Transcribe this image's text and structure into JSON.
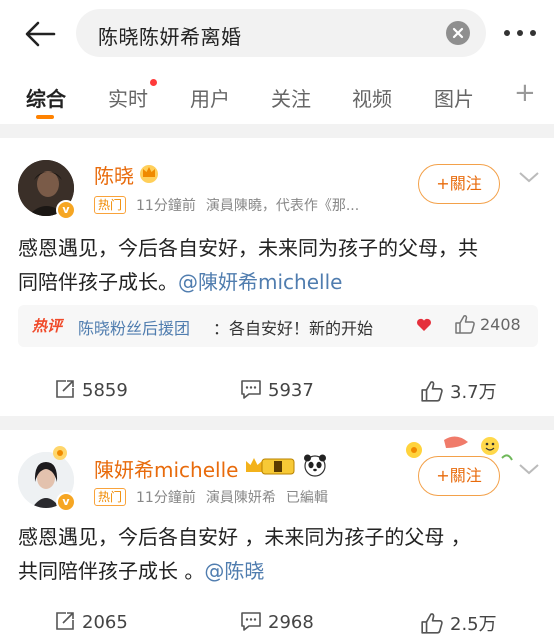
{
  "search": {
    "query": "陈晓陈妍希离婚"
  },
  "tabs": [
    {
      "label": "综合"
    },
    {
      "label": "实时"
    },
    {
      "label": "用户"
    },
    {
      "label": "关注"
    },
    {
      "label": "视频"
    },
    {
      "label": "图片"
    }
  ],
  "posts": [
    {
      "name": "陈晓",
      "hot_tag": "热门",
      "time": "11分鐘前",
      "desc": "演員陳曉，代表作《那...",
      "edited": "",
      "follow_label": "+關注",
      "text_1": "感恩遇见，今后各自安好，未来同为孩子的父母，共",
      "text_2": "同陪伴孩子成长。",
      "mention": "@陳妍希michelle",
      "hot_comment": {
        "tag": "热评",
        "user": "陈晓粉丝后援团",
        "text": "：各自安好！新的开始",
        "likes": "2408"
      },
      "reposts": "5859",
      "comments": "5937",
      "likes": "3.7万"
    },
    {
      "name": "陳妍希michelle",
      "hot_tag": "热门",
      "time": "11分鐘前",
      "desc": "演員陳妍希",
      "edited": "已編輯",
      "follow_label": "+關注",
      "text_1": "感恩遇见，今后各自安好 ，未来同为孩子的父母 ，",
      "text_2": "共同陪伴孩子成长 。",
      "mention": "@陈晓",
      "reposts": "2065",
      "comments": "2968",
      "likes": "2.5万"
    }
  ],
  "colors": {
    "accent": "#ff8200",
    "name": "#e86b0c",
    "link": "#507daf"
  }
}
